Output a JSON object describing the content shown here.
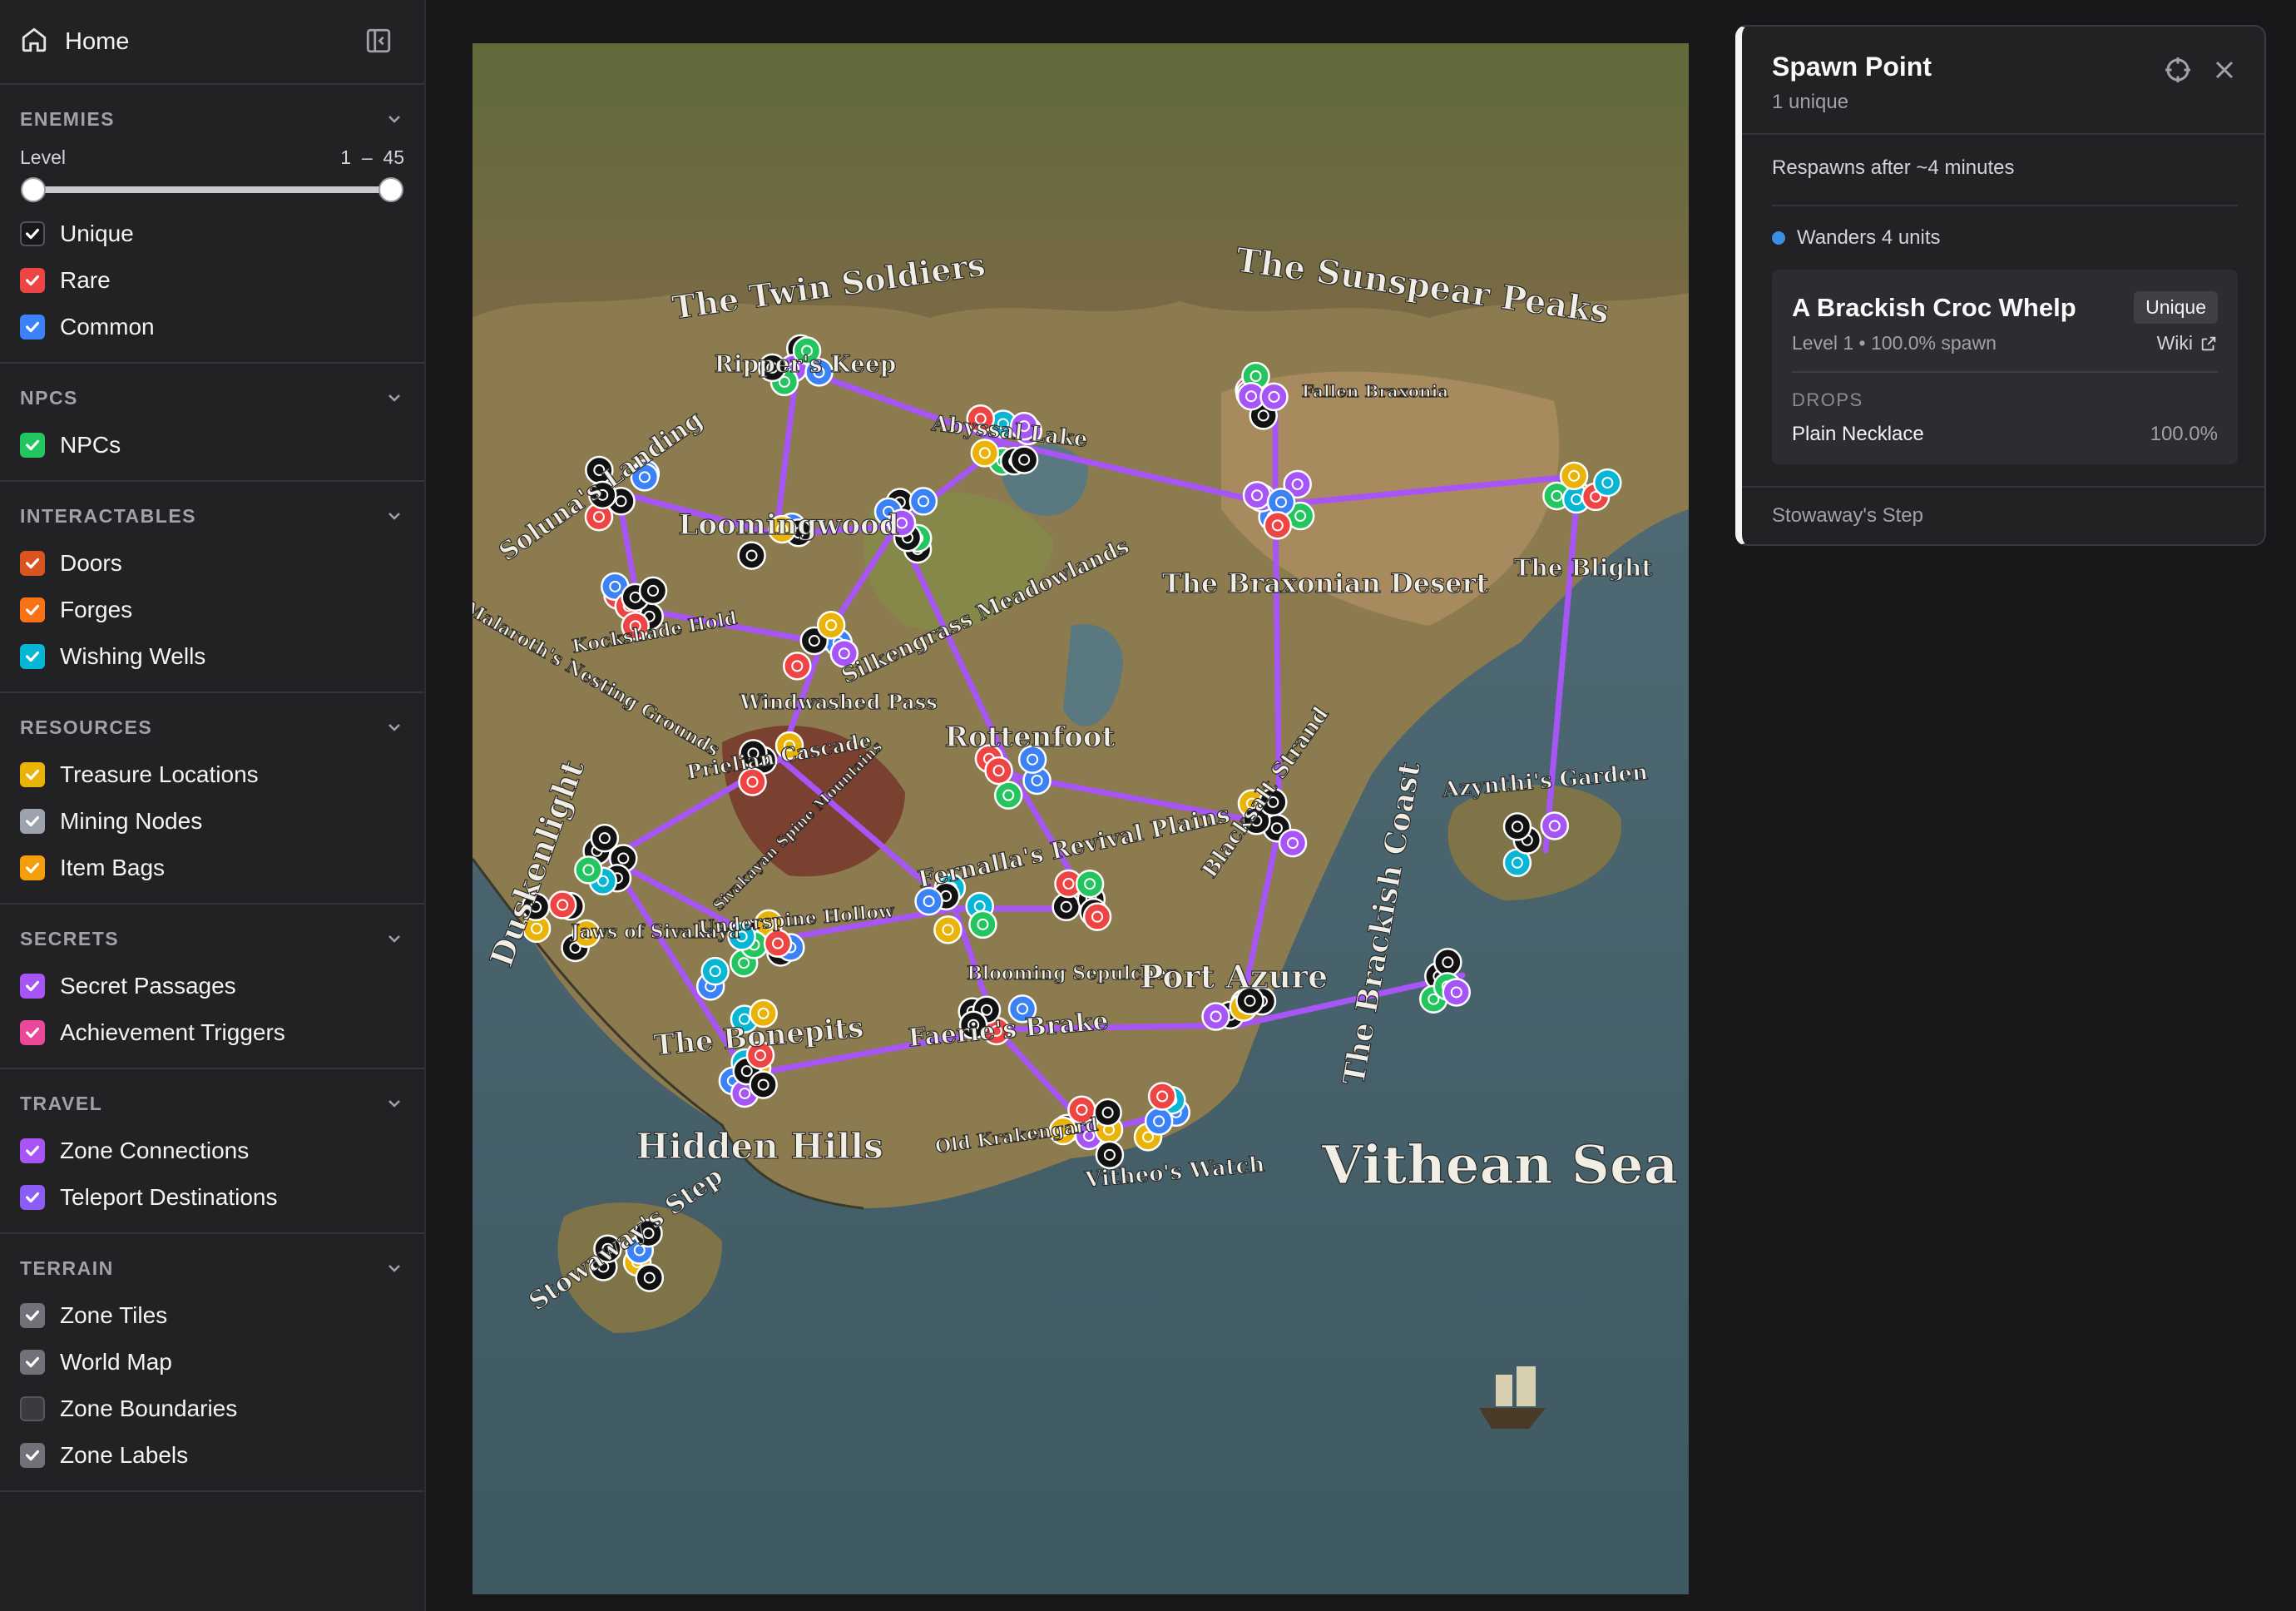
{
  "sidebar": {
    "home_label": "Home",
    "sections": [
      {
        "title": "ENEMIES",
        "level": {
          "label": "Level",
          "min": "1",
          "sep": "–",
          "max": "45"
        },
        "items": [
          {
            "label": "Unique",
            "checked": true,
            "color": "#18181b"
          },
          {
            "label": "Rare",
            "checked": true,
            "color": "#ef4444"
          },
          {
            "label": "Common",
            "checked": true,
            "color": "#3b82f6"
          }
        ]
      },
      {
        "title": "NPCS",
        "items": [
          {
            "label": "NPCs",
            "checked": true,
            "color": "#22c55e"
          }
        ]
      },
      {
        "title": "INTERACTABLES",
        "items": [
          {
            "label": "Doors",
            "checked": true,
            "color": "#d9541e"
          },
          {
            "label": "Forges",
            "checked": true,
            "color": "#f97316"
          },
          {
            "label": "Wishing Wells",
            "checked": true,
            "color": "#06b6d4"
          }
        ]
      },
      {
        "title": "RESOURCES",
        "items": [
          {
            "label": "Treasure Locations",
            "checked": true,
            "color": "#eab308"
          },
          {
            "label": "Mining Nodes",
            "checked": true,
            "color": "#9ca3af"
          },
          {
            "label": "Item Bags",
            "checked": true,
            "color": "#f59e0b"
          }
        ]
      },
      {
        "title": "SECRETS",
        "items": [
          {
            "label": "Secret Passages",
            "checked": true,
            "color": "#a855f7"
          },
          {
            "label": "Achievement Triggers",
            "checked": true,
            "color": "#ec4899"
          }
        ]
      },
      {
        "title": "TRAVEL",
        "items": [
          {
            "label": "Zone Connections",
            "checked": true,
            "color": "#a855f7"
          },
          {
            "label": "Teleport Destinations",
            "checked": true,
            "color": "#8b5cf6"
          }
        ]
      },
      {
        "title": "TERRAIN",
        "items": [
          {
            "label": "Zone Tiles",
            "checked": true,
            "color": "#71717a"
          },
          {
            "label": "World Map",
            "checked": true,
            "color": "#71717a"
          },
          {
            "label": "Zone Boundaries",
            "checked": false,
            "color": "#71717a"
          },
          {
            "label": "Zone Labels",
            "checked": true,
            "color": "#71717a"
          }
        ]
      }
    ]
  },
  "map": {
    "labels": [
      "The Twin Soldiers",
      "The Sunspear Peaks",
      "Ripper's Keep",
      "Fallen Braxonia",
      "Abyssal Lake",
      "Soluna's Landing",
      "Loomingwood",
      "Kockshade Hold",
      "Silkengrass Meadowlands",
      "The Braxonian Desert",
      "The Blight",
      "Malaroth's Nesting Grounds",
      "Windwashed Pass",
      "Rottenfoot",
      "Prielian Cascade",
      "Duskenlight",
      "Sivakayan Spine Mountains",
      "Fernalla's Revival Plains",
      "Blacksalt Strand",
      "The Brackish Coast",
      "Azynthi's Garden",
      "Jaws of Sivakaya",
      "Underspine Hollow",
      "Blooming Sepulcher",
      "Port Azure",
      "The Bonepits",
      "Faerie's Brake",
      "Hidden Hills",
      "Old Krakengard",
      "Vitheo's Watch",
      "Vithean Sea",
      "Stowaway's Step"
    ]
  },
  "panel": {
    "title": "Spawn Point",
    "subtitle": "1 unique",
    "respawn": "Respawns after ~4 minutes",
    "wander": "Wanders 4 units",
    "enemy": {
      "name": "A Brackish Croc Whelp",
      "badge": "Unique",
      "meta": "Level 1 • 100.0% spawn",
      "wiki": "Wiki"
    },
    "drops_label": "DROPS",
    "drops": [
      {
        "name": "Plain Necklace",
        "rate": "100.0%"
      }
    ],
    "footer": "Stowaway's Step"
  },
  "colors": {
    "accent": "#a855f7",
    "sea": "#4a6470",
    "land": "#8a7a50",
    "panel_bg": "#222225"
  }
}
